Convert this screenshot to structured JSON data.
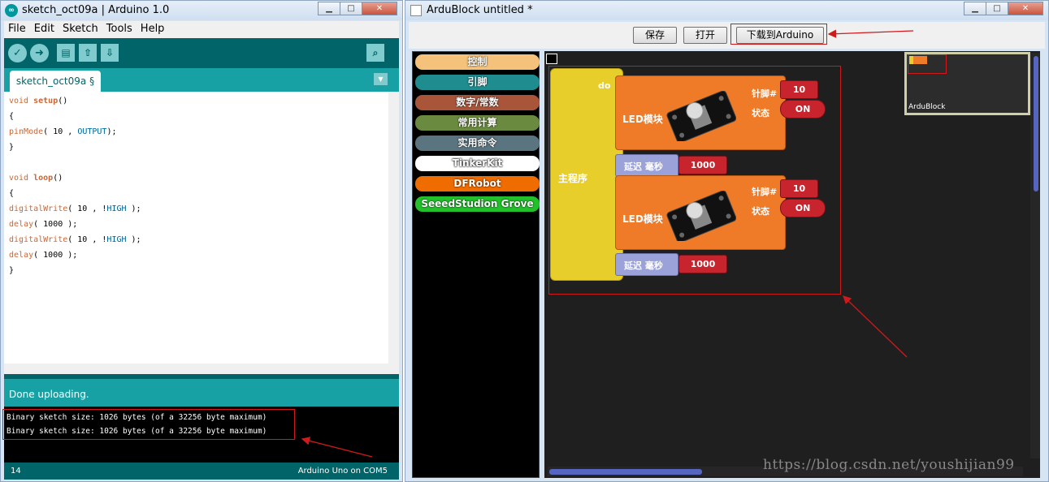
{
  "ide": {
    "title": "sketch_oct09a | Arduino 1.0",
    "menu": [
      "File",
      "Edit",
      "Sketch",
      "Tools",
      "Help"
    ],
    "toolbar": {
      "verify_icon": "check-icon",
      "upload_icon": "arrow-right-icon",
      "new_icon": "new-file-icon",
      "open_icon": "arrow-up-icon",
      "save_icon": "arrow-down-icon",
      "serial_icon": "magnifier-icon"
    },
    "tab": "sketch_oct09a §",
    "code": [
      {
        "a": "void ",
        "b": "setup",
        "c": "()"
      },
      {
        "a": "{",
        "b": "",
        "c": ""
      },
      {
        "a": "pinMode",
        "b": "( 10 , ",
        "c": "OUTPUT",
        "d": ");"
      },
      {
        "a": "}",
        "b": "",
        "c": ""
      },
      {
        "a": "",
        "b": "",
        "c": ""
      },
      {
        "a": "void ",
        "b": "loop",
        "c": "()"
      },
      {
        "a": "{",
        "b": "",
        "c": ""
      },
      {
        "a": "digitalWrite",
        "b": "( 10 , !",
        "c": "HIGH",
        "d": " );"
      },
      {
        "a": "delay",
        "b": "( 1000 );",
        "c": ""
      },
      {
        "a": "digitalWrite",
        "b": "( 10 , !",
        "c": "HIGH",
        "d": " );"
      },
      {
        "a": "delay",
        "b": "( 1000 );",
        "c": ""
      },
      {
        "a": "}",
        "b": "",
        "c": ""
      }
    ],
    "status": "Done uploading.",
    "console": [
      "Binary sketch size: 1026 bytes (of a 32256 byte maximum)",
      "Binary sketch size: 1026 bytes (of a 32256 byte maximum)"
    ],
    "line_number": "14",
    "board": "Arduino Uno on COM5"
  },
  "ardublock": {
    "title": "ArduBlock untitled *",
    "buttons": {
      "save": "保存",
      "open": "打开",
      "upload": "下载到Arduino"
    },
    "palette": [
      {
        "label": "控制",
        "color": "#f4c27a"
      },
      {
        "label": "引脚",
        "color": "#1f8c90"
      },
      {
        "label": "数字/常数",
        "color": "#a9553a"
      },
      {
        "label": "常用计算",
        "color": "#6a8a3f"
      },
      {
        "label": "实用命令",
        "color": "#5a7480"
      },
      {
        "label": "TinkerKit",
        "color": "#ffffff"
      },
      {
        "label": "DFRobot",
        "color": "#ef6c00"
      },
      {
        "label": "SeeedStudion Grove",
        "color": "#22c02a"
      }
    ],
    "main_block": {
      "name": "主程序",
      "do": "do"
    },
    "led_blocks": [
      {
        "name": "LED模块",
        "pin_label": "针脚#",
        "state_label": "状态",
        "pin": "10",
        "state": "ON"
      },
      {
        "name": "LED模块",
        "pin_label": "针脚#",
        "state_label": "状态",
        "pin": "10",
        "state": "ON"
      }
    ],
    "delay_blocks": [
      {
        "label": "延迟 毫秒",
        "value": "1000"
      },
      {
        "label": "延迟 毫秒",
        "value": "1000"
      }
    ],
    "minimap_label": "ArduBlock"
  },
  "watermark": "https://blog.csdn.net/youshijian99",
  "colors": {
    "annotation_red": "#d0191b",
    "arduino_teal": "#17a1a5",
    "arduino_dark": "#006468"
  }
}
